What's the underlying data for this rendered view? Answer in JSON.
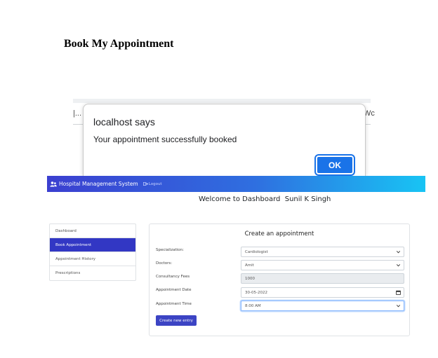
{
  "document": {
    "title": "Book My Appointment"
  },
  "background_page": {
    "fragment_left": "|...",
    "fragment_right": "Wc"
  },
  "alert": {
    "title": "localhost says",
    "message": "Your appointment successfully booked",
    "ok_label": "OK"
  },
  "app": {
    "brand": "Hospital Management System",
    "brand_icon": "users-icon",
    "logout_label": "Logout",
    "logout_icon": "logout-icon",
    "welcome": "Welcome to Dashboard  Sunil K Singh",
    "colors": {
      "nav_start": "#3b3fd0",
      "nav_end": "#18c4f4",
      "accent": "#3237c4"
    }
  },
  "sidebar": {
    "items": [
      {
        "label": "Dashboard",
        "active": false
      },
      {
        "label": "Book Appointment",
        "active": true
      },
      {
        "label": "Appointment History",
        "active": false
      },
      {
        "label": "Prescriptions",
        "active": false
      }
    ]
  },
  "form": {
    "title": "Create an appointment",
    "fields": [
      {
        "label": "Specialization:",
        "value": "Cardiologist",
        "kind": "select"
      },
      {
        "label": "Doctors:",
        "value": "Amit",
        "kind": "select"
      },
      {
        "label": "Consultancy Fees",
        "value": "1000",
        "kind": "readonly"
      },
      {
        "label": "Appointment Date",
        "value": "30-05-2022",
        "kind": "date"
      },
      {
        "label": "Appointment Time",
        "value": "8:00 AM",
        "kind": "select"
      }
    ],
    "submit_label": "Create new entry"
  }
}
